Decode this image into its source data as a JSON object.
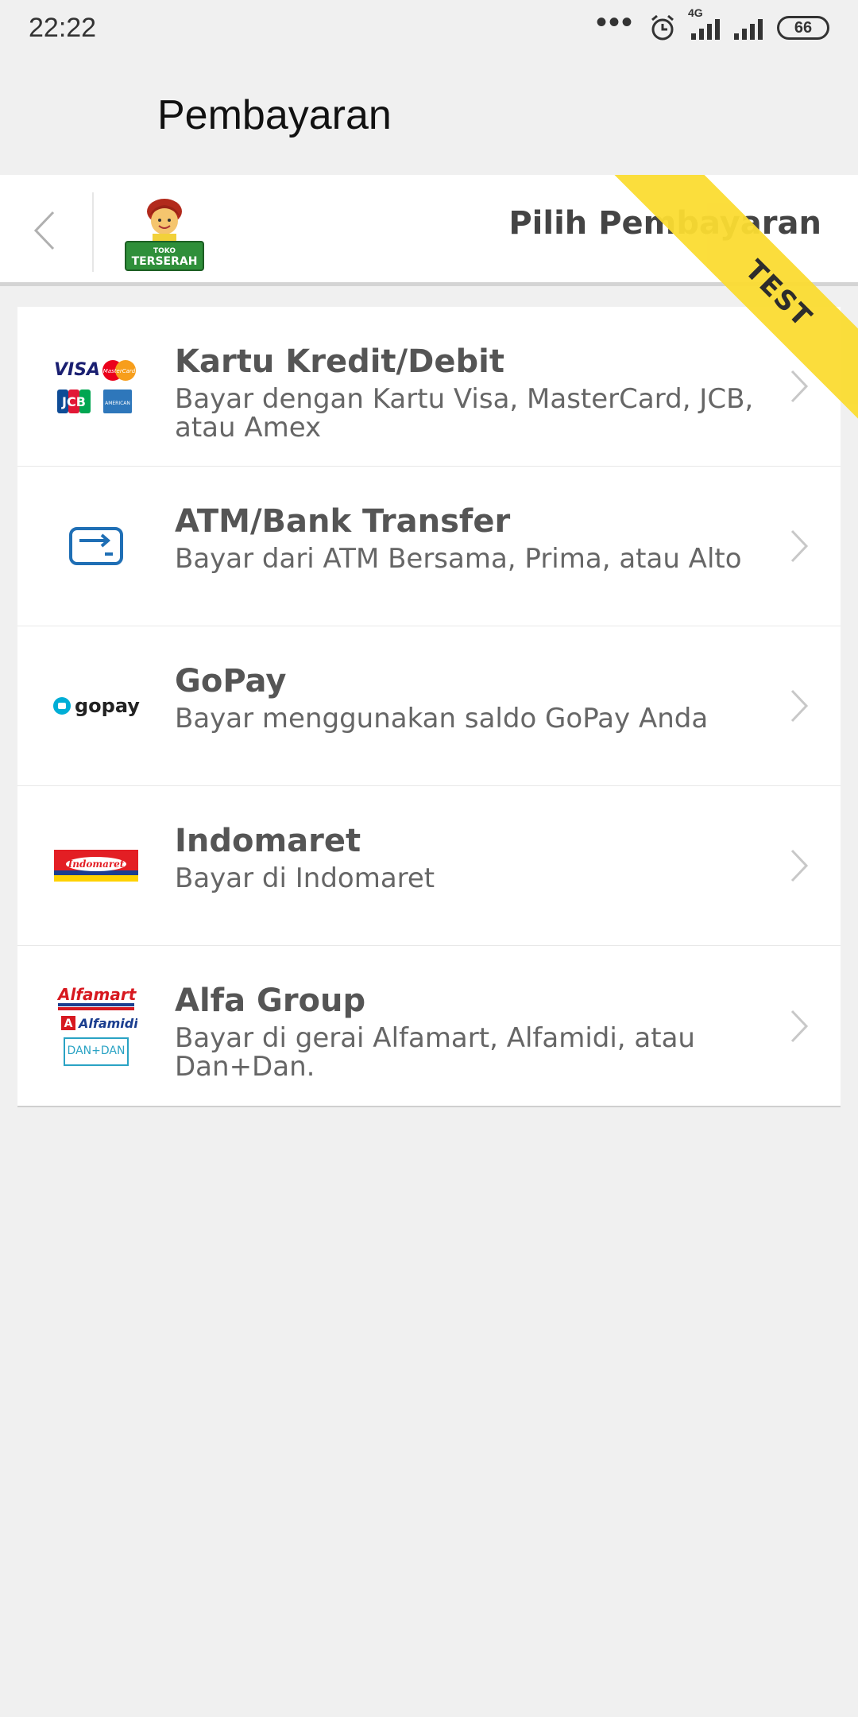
{
  "status_bar": {
    "time": "22:22",
    "dots": "•••",
    "network": "4G",
    "battery": "66"
  },
  "app": {
    "title": "Pembayaran"
  },
  "snap": {
    "title": "Pilih Pembayaran",
    "merchant_logo": "toko-terserah-logo",
    "ribbon": "TEST"
  },
  "payment_methods": [
    {
      "name": "Kartu Kredit/Debit",
      "description": "Bayar dengan Kartu Visa, MasterCard, JCB, atau Amex",
      "icon": "card-brands-icon"
    },
    {
      "name": "ATM/Bank Transfer",
      "description": "Bayar dari ATM Bersama, Prima, atau Alto",
      "icon": "bank-transfer-icon"
    },
    {
      "name": "GoPay",
      "description": "Bayar menggunakan saldo GoPay Anda",
      "icon": "gopay-logo",
      "logo_text": "gopay"
    },
    {
      "name": "Indomaret",
      "description": "Bayar di Indomaret",
      "icon": "indomaret-logo",
      "logo_text": "Indomaret"
    },
    {
      "name": "Alfa Group",
      "description": "Bayar di gerai Alfamart, Alfamidi, atau Dan+Dan.",
      "icon": "alfa-group-logo",
      "logo_text": [
        "Alfamart",
        "Alfamidi",
        "DAN+DAN"
      ]
    }
  ],
  "colors": {
    "ribbon": "#fbdc32",
    "bank_icon": "#1f6fb5",
    "gopay": "#00aed6",
    "indomaret_red": "#e31e24",
    "indomaret_blue": "#1b3e8f",
    "indomaret_yellow": "#ffd200"
  }
}
